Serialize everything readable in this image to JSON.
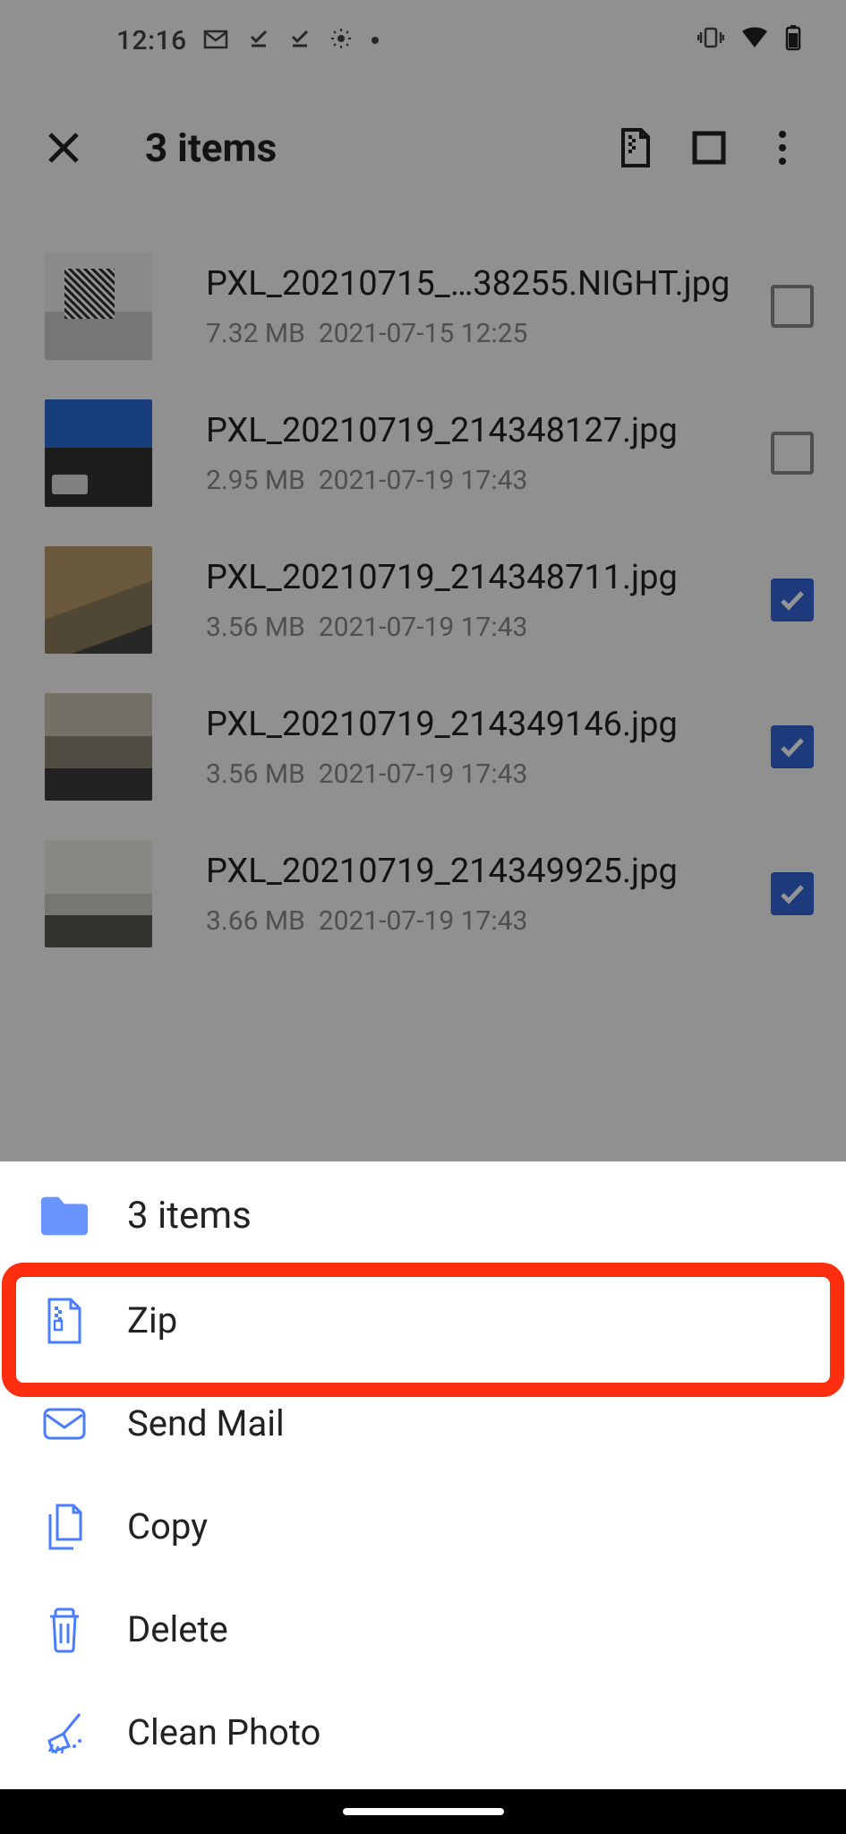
{
  "statusbar": {
    "time": "12:16"
  },
  "toolbar": {
    "title": "3 items"
  },
  "files": [
    {
      "name": "PXL_20210715_…38255.NIGHT.jpg",
      "size": "7.32 MB",
      "date": "2021-07-15 12:25",
      "checked": false
    },
    {
      "name": "PXL_20210719_214348127.jpg",
      "size": "2.95 MB",
      "date": "2021-07-19 17:43",
      "checked": false
    },
    {
      "name": "PXL_20210719_214348711.jpg",
      "size": "3.56 MB",
      "date": "2021-07-19 17:43",
      "checked": true
    },
    {
      "name": "PXL_20210719_214349146.jpg",
      "size": "3.56 MB",
      "date": "2021-07-19 17:43",
      "checked": true
    },
    {
      "name": "PXL_20210719_214349925.jpg",
      "size": "3.66 MB",
      "date": "2021-07-19 17:43",
      "checked": true
    }
  ],
  "sheet": {
    "header": "3 items",
    "items": [
      {
        "icon": "zip",
        "label": "Zip",
        "highlighted": true
      },
      {
        "icon": "mail",
        "label": "Send Mail",
        "highlighted": false
      },
      {
        "icon": "copy",
        "label": "Copy",
        "highlighted": false
      },
      {
        "icon": "delete",
        "label": "Delete",
        "highlighted": false
      },
      {
        "icon": "clean",
        "label": "Clean Photo",
        "highlighted": false
      }
    ]
  }
}
